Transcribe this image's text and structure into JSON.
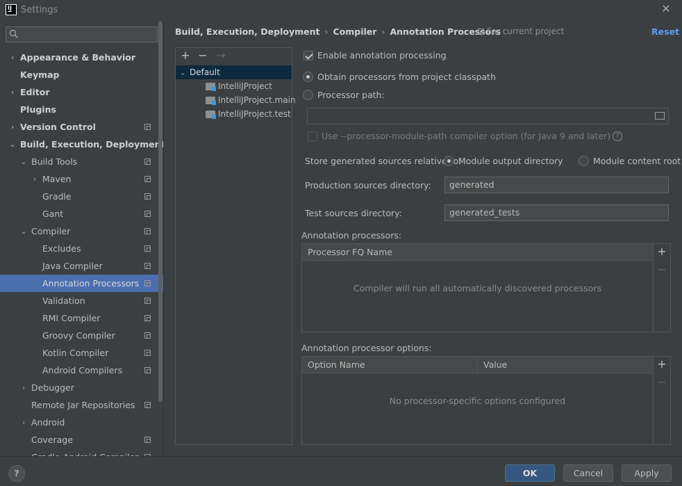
{
  "window": {
    "title": "Settings",
    "app_icon_text": "IJ"
  },
  "sidebar": {
    "search_placeholder": "",
    "items": [
      {
        "label": "Appearance & Behavior",
        "bold": true,
        "chevron": "›",
        "level": 0,
        "copy": false
      },
      {
        "label": "Keymap",
        "bold": true,
        "chevron": "",
        "level": 0,
        "copy": false
      },
      {
        "label": "Editor",
        "bold": true,
        "chevron": "›",
        "level": 0,
        "copy": false
      },
      {
        "label": "Plugins",
        "bold": true,
        "chevron": "",
        "level": 0,
        "copy": false
      },
      {
        "label": "Version Control",
        "bold": true,
        "chevron": "›",
        "level": 0,
        "copy": true
      },
      {
        "label": "Build, Execution, Deployment",
        "bold": true,
        "chevron": "⌄",
        "level": 0,
        "copy": false
      },
      {
        "label": "Build Tools",
        "bold": false,
        "chevron": "⌄",
        "level": 1,
        "copy": true
      },
      {
        "label": "Maven",
        "bold": false,
        "chevron": "›",
        "level": 2,
        "copy": true
      },
      {
        "label": "Gradle",
        "bold": false,
        "chevron": "",
        "level": 2,
        "copy": true
      },
      {
        "label": "Gant",
        "bold": false,
        "chevron": "",
        "level": 2,
        "copy": true
      },
      {
        "label": "Compiler",
        "bold": false,
        "chevron": "⌄",
        "level": 1,
        "copy": true
      },
      {
        "label": "Excludes",
        "bold": false,
        "chevron": "",
        "level": 2,
        "copy": true
      },
      {
        "label": "Java Compiler",
        "bold": false,
        "chevron": "",
        "level": 2,
        "copy": true
      },
      {
        "label": "Annotation Processors",
        "bold": false,
        "chevron": "",
        "level": 2,
        "copy": true,
        "selected": true
      },
      {
        "label": "Validation",
        "bold": false,
        "chevron": "",
        "level": 2,
        "copy": true
      },
      {
        "label": "RMI Compiler",
        "bold": false,
        "chevron": "",
        "level": 2,
        "copy": true
      },
      {
        "label": "Groovy Compiler",
        "bold": false,
        "chevron": "",
        "level": 2,
        "copy": true
      },
      {
        "label": "Kotlin Compiler",
        "bold": false,
        "chevron": "",
        "level": 2,
        "copy": true
      },
      {
        "label": "Android Compilers",
        "bold": false,
        "chevron": "",
        "level": 2,
        "copy": true
      },
      {
        "label": "Debugger",
        "bold": false,
        "chevron": "›",
        "level": 1,
        "copy": false
      },
      {
        "label": "Remote Jar Repositories",
        "bold": false,
        "chevron": "",
        "level": 1,
        "copy": true
      },
      {
        "label": "Android",
        "bold": false,
        "chevron": "›",
        "level": 1,
        "copy": false
      },
      {
        "label": "Coverage",
        "bold": false,
        "chevron": "",
        "level": 1,
        "copy": true
      },
      {
        "label": "Gradle-Android Compiler",
        "bold": false,
        "chevron": "",
        "level": 1,
        "copy": true
      }
    ]
  },
  "breadcrumb": {
    "parts": [
      "Build, Execution, Deployment",
      "Compiler",
      "Annotation Processors"
    ],
    "separator": "›",
    "scope_label": "For current project",
    "reset_label": "Reset"
  },
  "profiles": {
    "toolbar": {
      "add": "+",
      "remove": "−",
      "move": "→"
    },
    "default_label": "Default",
    "modules": [
      "IntelliJProject",
      "IntelliJProject.main",
      "IntelliJProject.test"
    ]
  },
  "settings": {
    "enable_label": "Enable annotation processing",
    "enable_checked": true,
    "obtain_label": "Obtain processors from project classpath",
    "processor_path_label": "Processor path:",
    "processor_path_value": "",
    "module_path_label": "Use --processor-module-path compiler option (for Java 9 and later)",
    "store_label": "Store generated sources relative to:",
    "module_output_label": "Module output directory",
    "module_content_label": "Module content root",
    "production_label": "Production sources directory:",
    "production_value": "generated",
    "test_label": "Test sources directory:",
    "test_value": "generated_tests"
  },
  "processors_table": {
    "section_label": "Annotation processors:",
    "column": "Processor FQ Name",
    "empty_text": "Compiler will run all automatically discovered processors"
  },
  "options_table": {
    "section_label": "Annotation processor options:",
    "columns": [
      "Option Name",
      "Value"
    ],
    "empty_text": "No processor-specific options configured"
  },
  "footer": {
    "help": "?",
    "ok": "OK",
    "cancel": "Cancel",
    "apply": "Apply"
  }
}
